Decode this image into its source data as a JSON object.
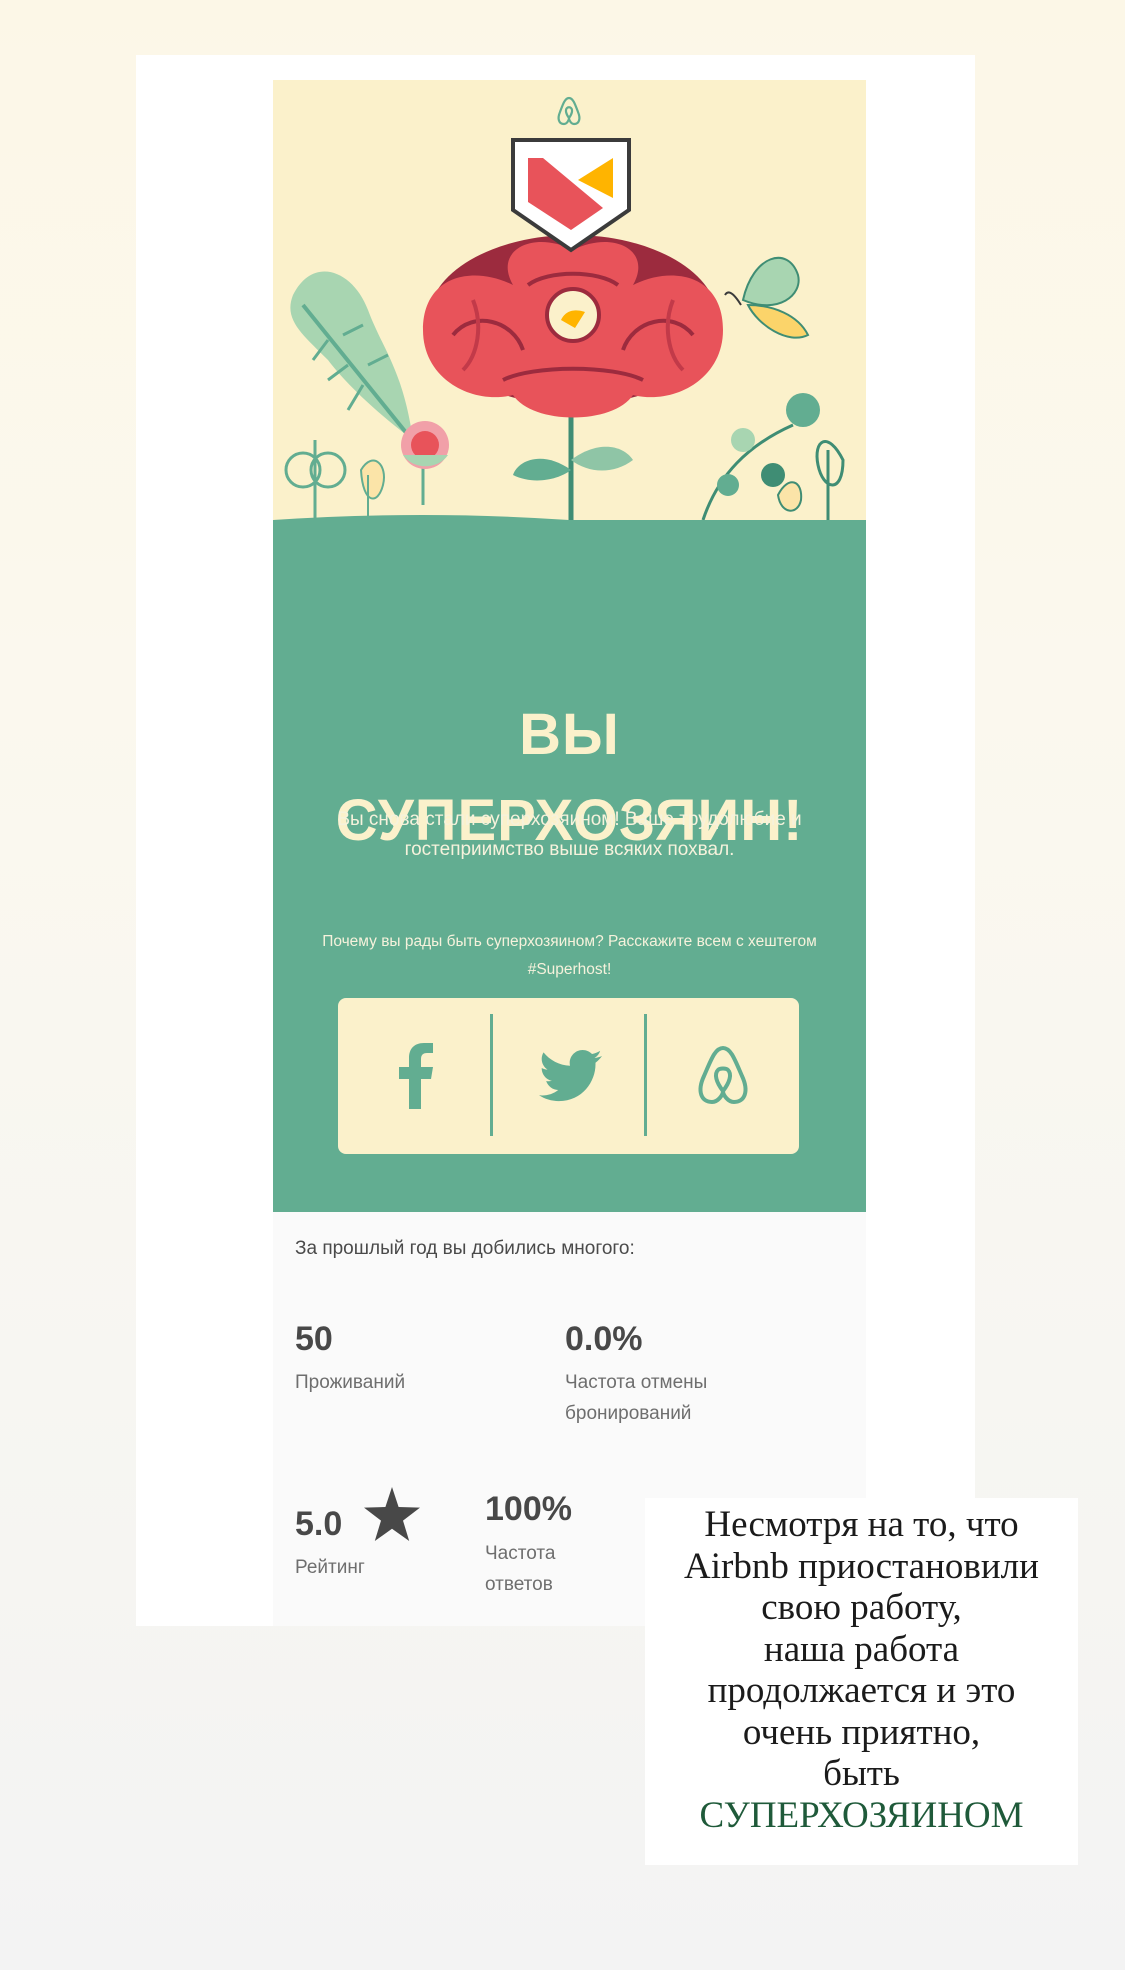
{
  "email": {
    "title_line1": "ВЫ",
    "title_line2": "СУПЕРХОЗЯИН!",
    "subtitle": "Вы снова стали суперхозяином! Ваше трудолюбие и гостеприимство выше всяких похвал.",
    "hashtag_prompt": "Почему вы рады быть суперхозяином? Расскажите всем с хештегом #Superhost!",
    "share_buttons": [
      {
        "icon": "facebook-icon"
      },
      {
        "icon": "twitter-icon"
      },
      {
        "icon": "airbnb-icon"
      }
    ],
    "achievements_heading": "За прошлый год вы добились многого:",
    "stats": {
      "stays": {
        "value": "50",
        "label": "Проживаний"
      },
      "cancellation": {
        "value": "0.0%",
        "label": "Частота отмены бронирований"
      },
      "rating": {
        "value": "5.0",
        "label": "Рейтинг",
        "icon": "star-icon"
      },
      "response": {
        "value": "100%",
        "label": "Частота ответов"
      }
    }
  },
  "caption": {
    "lines": [
      "Несмотря на то, что",
      "Airbnb приостановили",
      "свою работу,",
      "наша работа",
      "продолжается и это",
      "очень приятно,",
      "быть"
    ],
    "highlight": "СУПЕРХОЗЯИНОМ"
  },
  "colors": {
    "green": "#62ad91",
    "cream": "#fbf1cb",
    "coral": "#e8535a",
    "caption_highlight": "#1f5a3a"
  }
}
